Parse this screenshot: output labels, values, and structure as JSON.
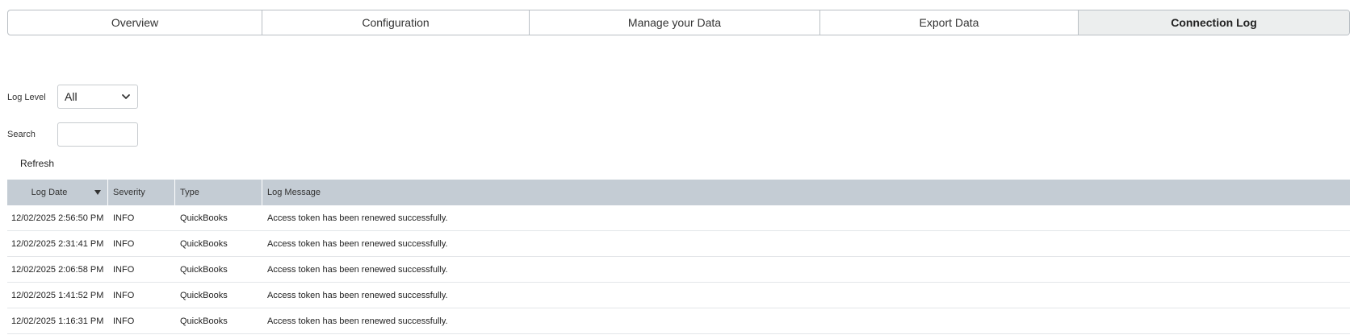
{
  "tabs": [
    {
      "label": "Overview",
      "width": 315,
      "active": false
    },
    {
      "label": "Configuration",
      "width": 331,
      "active": false
    },
    {
      "label": "Manage your Data",
      "width": 360,
      "active": false
    },
    {
      "label": "Export Data",
      "width": 320,
      "active": false
    },
    {
      "label": "Connection Log",
      "width": 337,
      "active": true
    }
  ],
  "filters": {
    "log_level_label": "Log Level",
    "log_level_value": "All",
    "search_label": "Search",
    "search_value": "",
    "search_placeholder": ""
  },
  "refresh_label": "Refresh",
  "grid": {
    "columns": [
      "Log Date",
      "Severity",
      "Type",
      "Log Message"
    ],
    "sorted_column": "Log Date",
    "sort_direction": "descending",
    "rows": [
      {
        "date": "12/02/2025 2:56:50 PM",
        "severity": "INFO",
        "type": "QuickBooks",
        "message": "Access token has been renewed successfully."
      },
      {
        "date": "12/02/2025 2:31:41 PM",
        "severity": "INFO",
        "type": "QuickBooks",
        "message": "Access token has been renewed successfully."
      },
      {
        "date": "12/02/2025 2:06:58 PM",
        "severity": "INFO",
        "type": "QuickBooks",
        "message": "Access token has been renewed successfully."
      },
      {
        "date": "12/02/2025 1:41:52 PM",
        "severity": "INFO",
        "type": "QuickBooks",
        "message": "Access token has been renewed successfully."
      },
      {
        "date": "12/02/2025 1:16:31 PM",
        "severity": "INFO",
        "type": "QuickBooks",
        "message": "Access token has been renewed successfully."
      }
    ]
  },
  "colors": {
    "header_bg": "#c4ccd4",
    "active_tab_bg": "#eceeee",
    "border": "#b9bfc4"
  }
}
